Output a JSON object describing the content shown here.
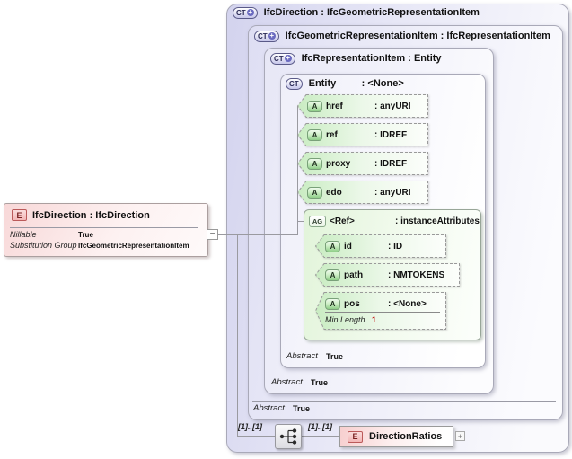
{
  "element_box": {
    "icon": "E",
    "title": "IfcDirection : IfcDirection",
    "rows": [
      {
        "label": "Nillable",
        "value": "True"
      },
      {
        "label": "Substitution Group",
        "value": "IfcGeometricRepresentationItem"
      }
    ]
  },
  "collapse_glyph": "−",
  "levels": {
    "l1": {
      "icon": "CT",
      "title": "IfcDirection : IfcGeometricRepresentationItem"
    },
    "l2": {
      "icon": "CT",
      "title": "IfcGeometricRepresentationItem : IfcRepresentationItem",
      "abstract_label": "Abstract",
      "abstract_value": "True"
    },
    "l3": {
      "icon": "CT",
      "title": "IfcRepresentationItem : Entity",
      "abstract_label": "Abstract",
      "abstract_value": "True"
    },
    "l4": {
      "icon": "CT",
      "name": "Entity",
      "type": ": <None>",
      "abstract_label": "Abstract",
      "abstract_value": "True"
    }
  },
  "entity_attributes": [
    {
      "icon": "A",
      "name": "href",
      "type": ": anyURI"
    },
    {
      "icon": "A",
      "name": "ref",
      "type": ": IDREF"
    },
    {
      "icon": "A",
      "name": "proxy",
      "type": ": IDREF"
    },
    {
      "icon": "A",
      "name": "edo",
      "type": ": anyURI"
    }
  ],
  "attribute_group": {
    "icon": "AG",
    "name": "<Ref>",
    "type": ": instanceAttributes",
    "attributes": [
      {
        "icon": "A",
        "name": "id",
        "type": ": ID"
      },
      {
        "icon": "A",
        "name": "path",
        "type": ": NMTOKENS"
      },
      {
        "icon": "A",
        "name": "pos",
        "type": ": <None>",
        "facet_label": "Min Length",
        "facet_value": "1"
      }
    ]
  },
  "content_row": {
    "cardinality_left": "[1]..[1]",
    "cardinality_right": "[1]..[1]",
    "element_icon": "E",
    "element_name": "DirectionRatios",
    "expand_glyph": "+"
  }
}
